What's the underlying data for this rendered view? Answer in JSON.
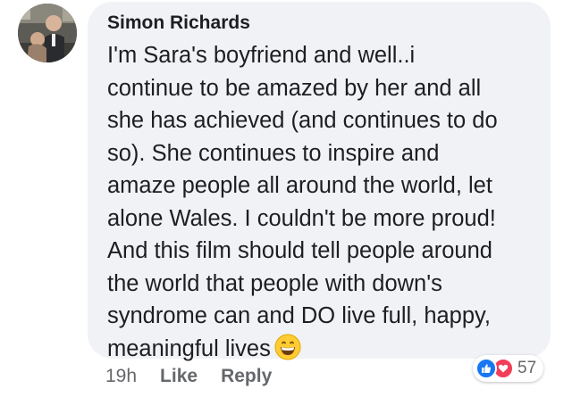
{
  "comment": {
    "author": "Simon Richards",
    "lines": [
      "I'm Sara's boyfriend and well..i",
      "continue to be amazed by her and all",
      "she has achieved (and continues to do",
      "so). She continues to inspire and",
      "amaze people all around the world, let",
      "alone Wales. I couldn't be more proud!",
      "And this film should tell people around",
      "the world that people with down's",
      "syndrome can and DO live full, happy,",
      "meaningful lives"
    ],
    "emoji": "grinning-face-emoji"
  },
  "actions": {
    "timestamp": "19h",
    "like_label": "Like",
    "reply_label": "Reply"
  },
  "reactions": {
    "types": [
      "like-icon",
      "love-icon"
    ],
    "count": "57"
  },
  "colors": {
    "bubble": "#f0f2f5",
    "like": "#1877f2",
    "love": "#f33e58",
    "secondary_text": "#65676b"
  }
}
